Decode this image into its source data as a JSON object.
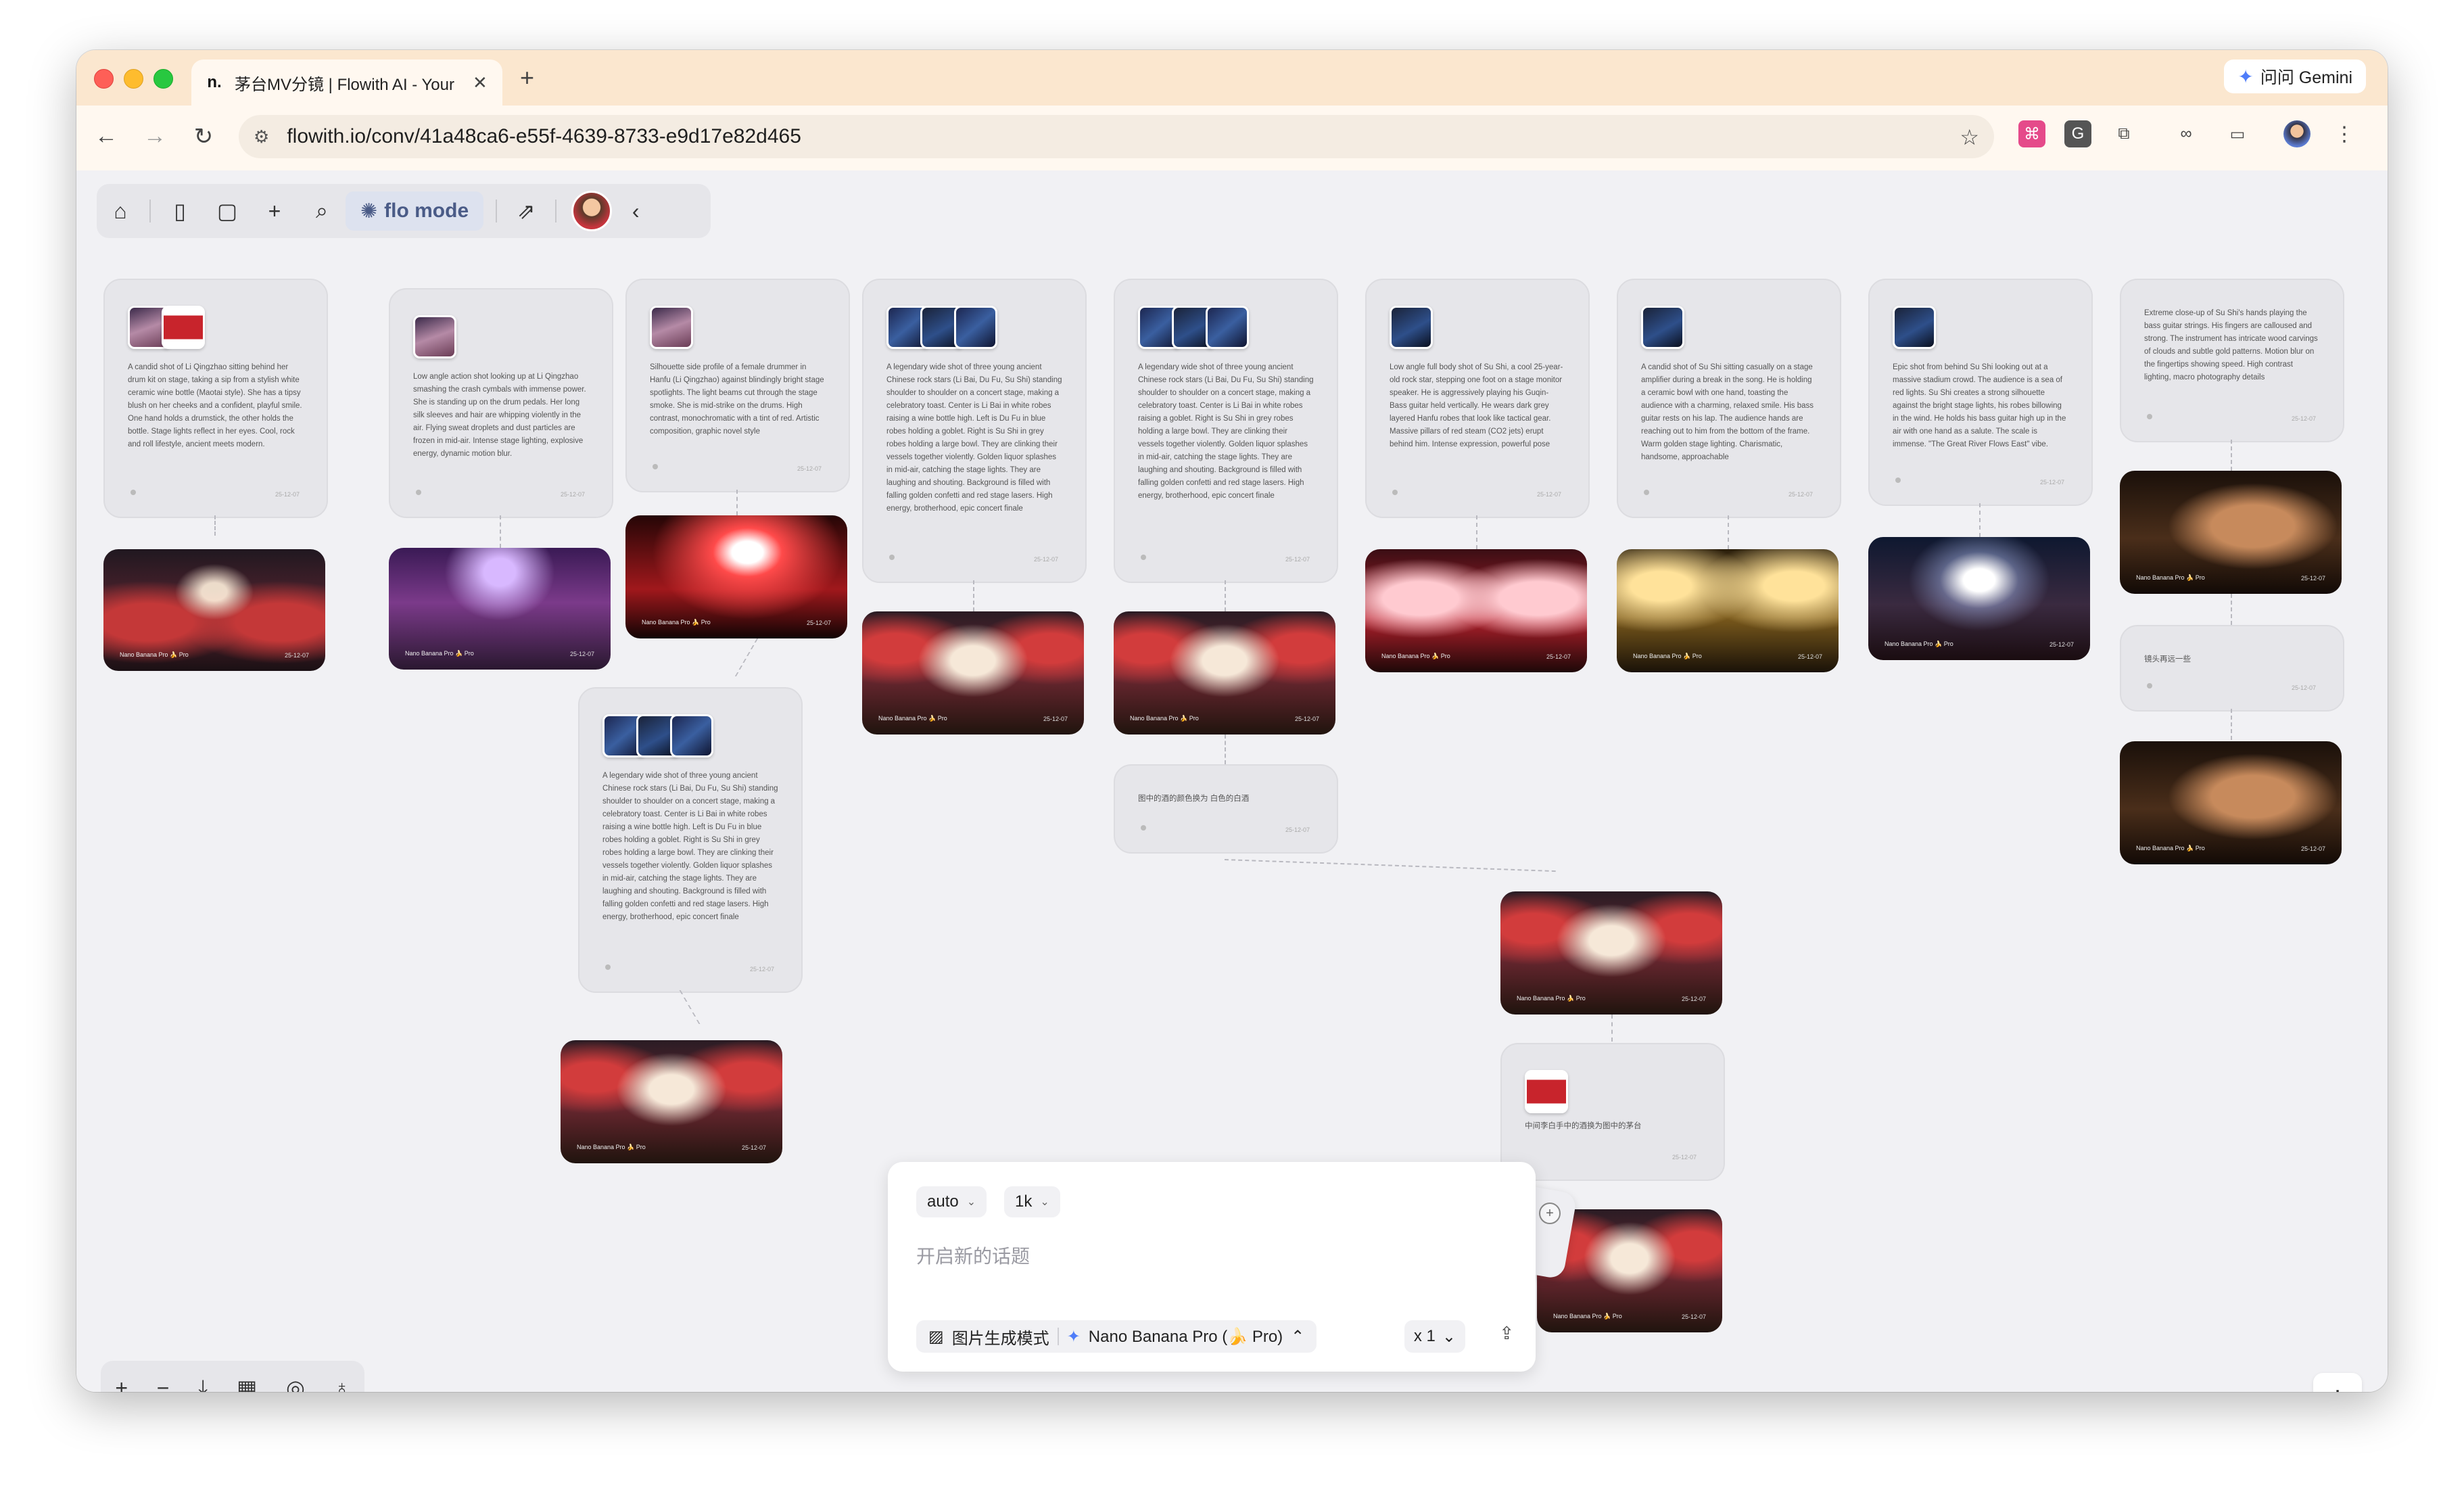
{
  "browser": {
    "tab_title": "茅台MV分镜 | Flowith AI - Your",
    "tab_favicon": "n.",
    "url": "flowith.io/conv/41a48ca6-e55f-4639-8733-e9d17e82d465",
    "gemini_label": "问问 Gemini",
    "icons": [
      "back-icon",
      "forward-icon",
      "reload-icon",
      "site-settings-icon",
      "bookmark-star-icon",
      "extension-icon",
      "link-icon",
      "cast-icon",
      "profile-avatar",
      "menu-dots-icon"
    ]
  },
  "toolbar": {
    "flo_mode_label": "flo mode",
    "icons": [
      "home-icon",
      "sidebar-icon",
      "chat-icon",
      "plus-icon",
      "search-icon",
      "share-icon",
      "avatar",
      "collapse-icon"
    ]
  },
  "cards": [
    {
      "id": "c1",
      "text": "A candid shot of Li Qingzhao sitting behind her drum kit on stage, taking a sip from a stylish white ceramic wine bottle (Maotai style). She has a tipsy blush on her cheeks and a confident, playful smile. One hand holds a drumstick, the other holds the bottle. Stage lights reflect in her eyes. Cool, rock and roll lifestyle, ancient meets modern.",
      "date": "25-12-07"
    },
    {
      "id": "c2",
      "text": "Low angle action shot looking up at Li Qingzhao smashing the crash cymbals with immense power. She is standing up on the drum pedals. Her long silk sleeves and hair are whipping violently in the air. Flying sweat droplets and dust particles are frozen in mid-air. Intense stage lighting, explosive energy, dynamic motion blur.",
      "date": "25-12-07"
    },
    {
      "id": "c3",
      "text": "Silhouette side profile of a female drummer in Hanfu (Li Qingzhao) against blindingly bright stage spotlights. The light beams cut through the stage smoke. She is mid-strike on the drums. High contrast, monochromatic with a tint of red. Artistic composition, graphic novel style",
      "date": "25-12-07"
    },
    {
      "id": "c4",
      "text": "A legendary wide shot of three young ancient Chinese rock stars (Li Bai, Du Fu, Su Shi) standing shoulder to shoulder on a concert stage, making a celebratory toast. Center is Li Bai in white robes raising a wine bottle high. Left is Du Fu in blue robes holding a goblet. Right is Su Shi in grey robes holding a large bowl. They are clinking their vessels together violently. Golden liquor splashes in mid-air, catching the stage lights. They are laughing and shouting. Background is filled with falling golden confetti and red stage lasers. High energy, brotherhood, epic concert finale",
      "date": "25-12-07"
    },
    {
      "id": "c5",
      "text": "A legendary wide shot of three young ancient Chinese rock stars (Li Bai, Du Fu, Su Shi) standing shoulder to shoulder on a concert stage, making a celebratory toast. Center is Li Bai in white robes raising a goblet. Right is Su Shi in grey robes holding a large bowl. They are clinking their vessels together violently. Golden liquor splashes in mid-air, catching the stage lights. They are laughing and shouting. Background is filled with falling golden confetti and red stage lasers. High energy, brotherhood, epic concert finale",
      "date": "25-12-07"
    },
    {
      "id": "c6",
      "text": "Low angle full body shot of Su Shi, a cool 25-year-old rock star, stepping one foot on a stage monitor speaker. He is aggressively playing his Guqin-Bass guitar held vertically. He wears dark grey layered Hanfu robes that look like tactical gear. Massive pillars of red steam (CO2 jets) erupt behind him. Intense expression, powerful pose",
      "date": "25-12-07"
    },
    {
      "id": "c7",
      "text": "A candid shot of Su Shi sitting casually on a stage amplifier during a break in the song. He is holding a ceramic bowl with one hand, toasting the audience with a charming, relaxed smile. His bass guitar rests on his lap. The audience hands are reaching out to him from the bottom of the frame. Warm golden stage lighting. Charismatic, handsome, approachable",
      "date": "25-12-07"
    },
    {
      "id": "c8",
      "text": "Epic shot from behind Su Shi looking out at a massive stadium crowd. The audience is a sea of red lights. Su Shi creates a strong silhouette against the bright stage lights, his robes billowing in the wind. He holds his bass guitar high up in the air with one hand as a salute. The scale is immense. \"The Great River Flows East\" vibe.",
      "date": "25-12-07"
    },
    {
      "id": "c9",
      "text": "Extreme close-up of Su Shi's hands playing the bass guitar strings. His fingers are calloused and strong. The instrument has intricate wood carvings of clouds and subtle gold patterns. Motion blur on the fingertips showing speed. High contrast lighting, macro photography details",
      "date": "25-12-07"
    },
    {
      "id": "c10",
      "text": "A legendary wide shot of three young ancient Chinese rock stars (Li Bai, Du Fu, Su Shi) standing shoulder to shoulder on a concert stage, making a celebratory toast. Center is Li Bai in white robes raising a wine bottle high. Left is Du Fu in blue robes holding a goblet. Right is Su Shi in grey robes holding a large bowl. They are clinking their vessels together violently. Golden liquor splashes in mid-air, catching the stage lights. They are laughing and shouting. Background is filled with falling golden confetti and red stage lasers. High energy, brotherhood, epic concert finale",
      "date": "25-12-07"
    },
    {
      "id": "c11",
      "text": "图中的酒的颜色换为 白色的白酒",
      "date": "25-12-07"
    },
    {
      "id": "c12",
      "text": "镜头再远一些",
      "date": "25-12-07"
    },
    {
      "id": "c13",
      "text": "中间李白手中的酒换为图中的茅台",
      "date": "25-12-07"
    }
  ],
  "image_badge": "Nano Banana Pro 🍌 Pro",
  "image_date": "25-12-07",
  "composer": {
    "ratio": "auto",
    "resolution": "1k",
    "placeholder": "开启新的话题",
    "mode_label": "图片生成模式",
    "model_label": "Nano Banana Pro (🍌 Pro)",
    "count_label": "x 1"
  },
  "bottom_tools": [
    "plus-icon",
    "minus-icon",
    "download-icon",
    "grid-icon",
    "compass-icon",
    "lightbulb-icon"
  ]
}
